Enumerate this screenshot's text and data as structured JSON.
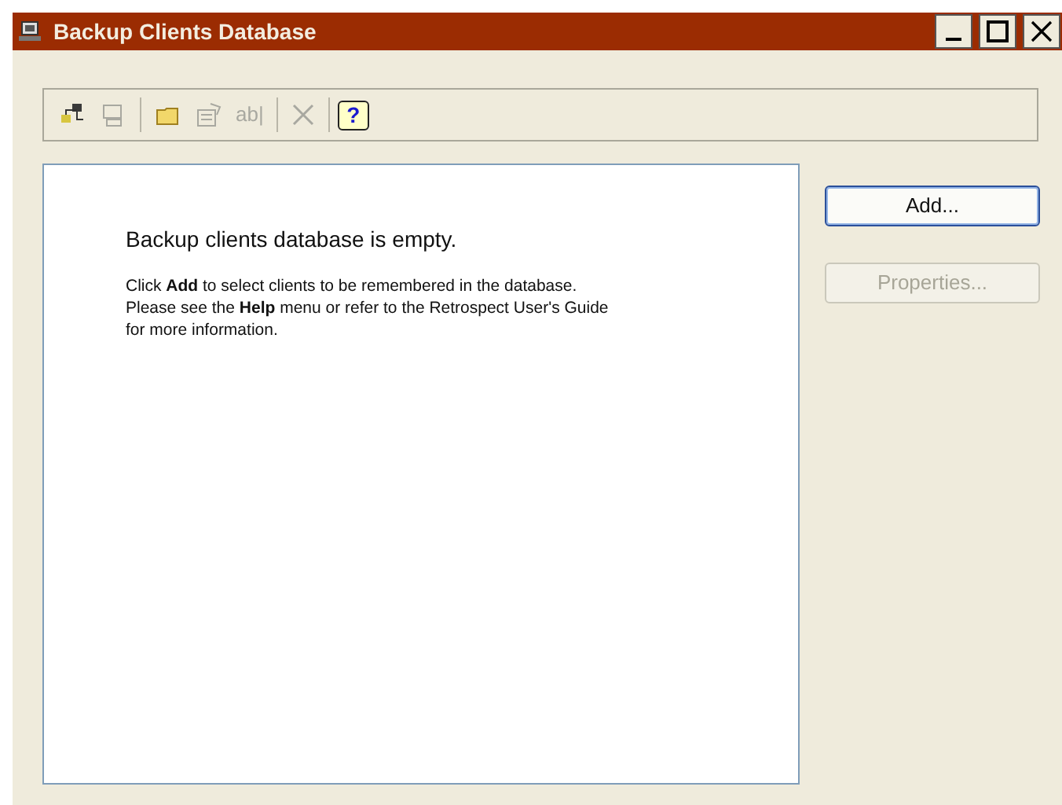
{
  "window": {
    "title": "Backup Clients Database"
  },
  "toolbar": [
    {
      "kind": "network",
      "disabled": false
    },
    {
      "kind": "computer",
      "disabled": true
    },
    {
      "kind": "separator"
    },
    {
      "kind": "folder",
      "disabled": false
    },
    {
      "kind": "properties",
      "disabled": true
    },
    {
      "kind": "rename",
      "label": "ab|",
      "disabled": true
    },
    {
      "kind": "separator"
    },
    {
      "kind": "delete",
      "disabled": true
    },
    {
      "kind": "separator"
    },
    {
      "kind": "help",
      "label": "?",
      "disabled": false
    }
  ],
  "panel": {
    "heading": "Backup clients database is empty.",
    "message": "Click **Add** to select clients to be remembered in the database. Please see the **Help** menu or refer to the Retrospect User's Guide for more information."
  },
  "buttons": [
    {
      "label": "Add...",
      "disabled": false,
      "focused": true
    },
    {
      "label": "Properties...",
      "disabled": true
    }
  ]
}
